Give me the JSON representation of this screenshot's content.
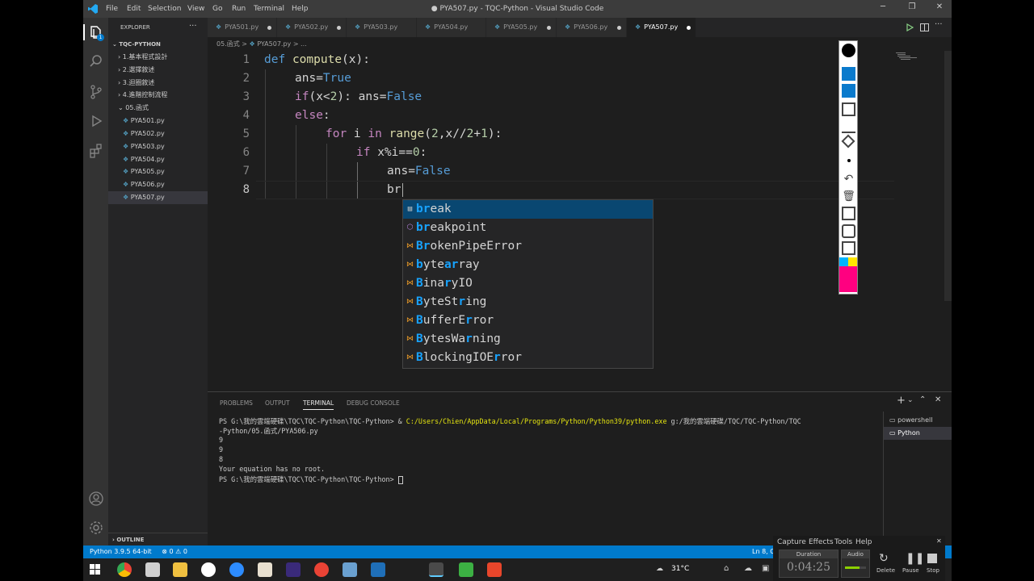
{
  "window": {
    "title": "● PYA507.py - TQC-Python - Visual Studio Code",
    "menu": [
      "File",
      "Edit",
      "Selection",
      "View",
      "Go",
      "Run",
      "Terminal",
      "Help"
    ]
  },
  "sidebar": {
    "header": "EXPLORER",
    "folder": "TQC-PYTHON",
    "folders": [
      "1.基本程式設計",
      "2.選擇敘述",
      "3.迴圈敘述",
      "4.進階控制流程",
      "05.函式"
    ],
    "files": [
      "PYA501.py",
      "PYA502.py",
      "PYA503.py",
      "PYA504.py",
      "PYA505.py",
      "PYA506.py",
      "PYA507.py"
    ],
    "outline": "OUTLINE",
    "badge": "1"
  },
  "tabs": [
    "PYA501.py",
    "PYA502.py",
    "PYA503.py",
    "PYA504.py",
    "PYA505.py",
    "PYA506.py",
    "PYA507.py"
  ],
  "breadcrumb": {
    "folder": "05.函式",
    "sep": ">",
    "file": "PYA507.py",
    "rest": "> ..."
  },
  "editor": {
    "line_numbers": [
      "1",
      "2",
      "3",
      "4",
      "5",
      "6",
      "7",
      "8"
    ],
    "lines": [
      [
        [
          "kw",
          "def"
        ],
        [
          "t",
          " "
        ],
        [
          "fn",
          "compute"
        ],
        [
          "t",
          "(x):"
        ]
      ],
      [
        [
          "t",
          "ans="
        ],
        [
          "cst",
          "True"
        ]
      ],
      [
        [
          "kwc",
          "if"
        ],
        [
          "t",
          "(x<"
        ],
        [
          "num",
          "2"
        ],
        [
          "t",
          "): ans="
        ],
        [
          "cst",
          "False"
        ]
      ],
      [
        [
          "kwc",
          "else"
        ],
        [
          "t",
          ":"
        ]
      ],
      [
        [
          "kwc",
          "for"
        ],
        [
          "t",
          " i "
        ],
        [
          "kwc",
          "in"
        ],
        [
          "t",
          " "
        ],
        [
          "fn",
          "range"
        ],
        [
          "t",
          "("
        ],
        [
          "num",
          "2"
        ],
        [
          "t",
          ",x//"
        ],
        [
          "num",
          "2"
        ],
        [
          "t",
          "+"
        ],
        [
          "num",
          "1"
        ],
        [
          "t",
          "):"
        ]
      ],
      [
        [
          "kwc",
          "if"
        ],
        [
          "t",
          " x%i=="
        ],
        [
          "num",
          "0"
        ],
        [
          "t",
          ":"
        ]
      ],
      [
        [
          "t",
          "ans="
        ],
        [
          "cst",
          "False"
        ]
      ],
      [
        [
          "t",
          "br"
        ]
      ]
    ]
  },
  "suggest": [
    {
      "pre": "",
      "hl": "br",
      "post": "eak",
      "icon": "keyword"
    },
    {
      "pre": "",
      "hl": "br",
      "post": "eakpoint",
      "icon": "function"
    },
    {
      "pre": "",
      "hl": "Br",
      "post": "okenPipeError",
      "icon": "class"
    },
    {
      "pre": "",
      "hl": "b",
      "mid": "yte",
      "hl2": "a",
      "mid2": "",
      "hl3": "r",
      "post": "ray",
      "icon": "class"
    },
    {
      "pre": "",
      "hl": "B",
      "mid": "ina",
      "hl2": "r",
      "post": "yIO",
      "icon": "class"
    },
    {
      "pre": "",
      "hl": "B",
      "mid": "yteSt",
      "hl2": "r",
      "post": "ing",
      "icon": "class"
    },
    {
      "pre": "",
      "hl": "B",
      "mid": "ufferE",
      "hl2": "r",
      "post": "ror",
      "icon": "class"
    },
    {
      "pre": "",
      "hl": "B",
      "mid": "ytesWa",
      "hl2": "r",
      "post": "ning",
      "icon": "class"
    },
    {
      "pre": "",
      "hl": "B",
      "mid": "lockingIOE",
      "hl2": "r",
      "post": "ror",
      "icon": "class"
    }
  ],
  "panel": {
    "tabs": [
      "PROBLEMS",
      "OUTPUT",
      "TERMINAL",
      "DEBUG CONSOLE"
    ],
    "terminal": {
      "line1_prompt": "PS G:\\我的雲端硬碟\\TQC\\TQC-Python\\TQC-Python> & ",
      "line1_exe": "C:/Users/Chien/AppData/Local/Programs/Python/Python39/python.exe",
      "line1_arg": " g:/我的雲端硬碟/TQC/TQC-Python/TQC",
      "line2": "-Python/05.函式/PYA506.py",
      "out1": "9",
      "out2": "9",
      "out3": "8",
      "out4": "Your equation has no root.",
      "prompt": "PS G:\\我的雲端硬碟\\TQC\\TQC-Python\\TQC-Python> "
    },
    "shells": [
      "powershell",
      "Python"
    ]
  },
  "statusbar": {
    "python": "Python 3.9.5 64-bit",
    "problems": "⊗ 0 ⚠ 0",
    "position": "Ln 8, Co"
  },
  "taskbar": {
    "weather": "31°C",
    "weather_icon": "cloud-icon"
  },
  "recorder": {
    "menu": [
      "Capture",
      "Effects",
      "Tools",
      "Help"
    ],
    "duration_label": "Duration",
    "duration": "0:04:25",
    "audio_label": "Audio",
    "delete": "Delete",
    "pause": "Pause",
    "stop": "Stop"
  },
  "colors": {
    "accent": "#007acc",
    "selection": "#094771",
    "highlight": "#18a3ff"
  }
}
